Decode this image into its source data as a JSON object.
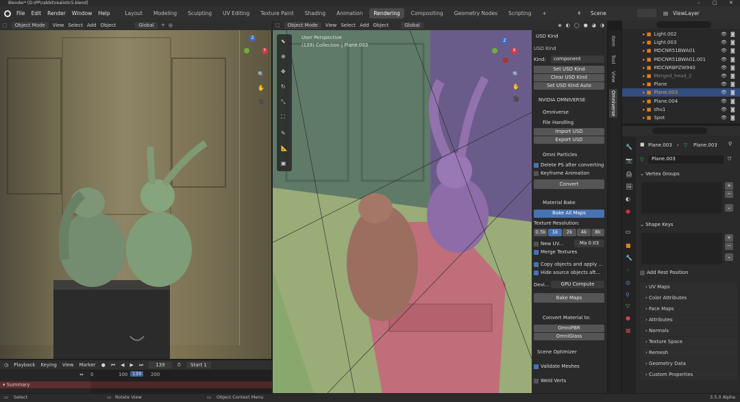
{
  "window": {
    "title": "Blender* [D:\\PP\\rabbit\\realistic5.blend]"
  },
  "menu": {
    "items": [
      "File",
      "Edit",
      "Render",
      "Window",
      "Help"
    ],
    "workspaces": [
      "Layout",
      "Modeling",
      "Sculpting",
      "UV Editing",
      "Texture Paint",
      "Shading",
      "Animation",
      "Rendering",
      "Compositing",
      "Geometry Nodes",
      "Scripting"
    ],
    "active": "Rendering",
    "plus": "+",
    "scene": "Scene",
    "viewlayer": "ViewLayer"
  },
  "left_header": {
    "mode": "Object Mode",
    "items": [
      "View",
      "Select",
      "Add",
      "Object"
    ],
    "orient": "Global"
  },
  "mid_header": {
    "mode": "Object Mode",
    "items": [
      "View",
      "Select",
      "Add",
      "Object"
    ],
    "orient": "Global"
  },
  "mid_overlay": {
    "view": "User Perspective",
    "collection": "(139) Collection | Plane.003"
  },
  "n_panel": {
    "tabs": [
      "Item",
      "Tool",
      "View",
      "Omniverse"
    ],
    "usd_kind": {
      "header": "USD Kind",
      "sub": "USD Kind",
      "kind_label": "Kind:",
      "kind_value": "component",
      "set": "Set USD Kind",
      "clear": "Clear USD Kind",
      "auto": "Set USD Kind Auto"
    },
    "nvidia": {
      "header": "NVIDIA OMNIVERSE",
      "omniverse": "Omniverse",
      "file_handling": "File Handling",
      "import": "Import USD",
      "export": "Export USD"
    },
    "particles": {
      "header": "Omni Particles",
      "delete": "Delete PS after converting",
      "keyframe": "Keyframe Animation",
      "convert": "Convert"
    },
    "bake": {
      "header": "Material Bake",
      "bake_all": "Bake All Maps",
      "res_label": "Texture Resolution:",
      "res": [
        "0.5k",
        "1k",
        "2k",
        "4k",
        "8k"
      ],
      "res_active": "1k",
      "new_uv": "New UV...",
      "ma_label": "Ma",
      "ma_value": "0.03",
      "merge": "Merge Textures",
      "copy": "Copy objects and apply ...",
      "hide": "Hide source objects aft...",
      "device_label": "Devi...",
      "device_value": "GPU Compute",
      "bake_maps": "Bake Maps"
    },
    "convert": {
      "header": "Convert Material to:",
      "pbr": "OmniPBR",
      "glass": "OmniGlass"
    },
    "optimizer": {
      "header": "Scene Optimizer",
      "validate": "Validate Meshes",
      "weld": "Weld Verts"
    }
  },
  "outliner": {
    "items": [
      {
        "name": "Light.002",
        "dim": false,
        "selected": false
      },
      {
        "name": "Light.003",
        "dim": false,
        "selected": false
      },
      {
        "name": "MDCNR51BWA01",
        "dim": false,
        "selected": false
      },
      {
        "name": "MDCNR51BWA01.001",
        "dim": false,
        "selected": false
      },
      {
        "name": "MDCNRBPZW940",
        "dim": false,
        "selected": false
      },
      {
        "name": "Merged_head_2",
        "dim": true,
        "selected": false
      },
      {
        "name": "Plane",
        "dim": false,
        "selected": false
      },
      {
        "name": "Plane.003",
        "dim": false,
        "selected": true
      },
      {
        "name": "Plane.004",
        "dim": false,
        "selected": false
      },
      {
        "name": "shu1",
        "dim": false,
        "selected": false
      },
      {
        "name": "Spot",
        "dim": false,
        "selected": false
      }
    ]
  },
  "properties": {
    "breadcrumb_a": "Plane.003",
    "breadcrumb_b": "Plane.003",
    "mesh_name": "Plane.003",
    "vertex_groups": "Vertex Groups",
    "shape_keys": "Shape Keys",
    "add_rest": "Add Rest Position",
    "sections": [
      "UV Maps",
      "Color Attributes",
      "Face Maps",
      "Attributes",
      "Normals",
      "Texture Space",
      "Remesh",
      "Geometry Data",
      "Custom Properties"
    ]
  },
  "timeline": {
    "items": [
      "Playback",
      "Keying",
      "View",
      "Marker"
    ],
    "frame": "139",
    "start_label": "Start",
    "start_value": "1",
    "ticks": [
      "0",
      "100",
      "200"
    ],
    "current": "139",
    "summary": "Summary"
  },
  "status": {
    "select": "Select",
    "rotate": "Rotate View",
    "context": "Object Context Menu",
    "version": "3.5.0 Alpha"
  },
  "colors": {
    "accent": "#4772b3",
    "selected_row": "#334d80"
  }
}
